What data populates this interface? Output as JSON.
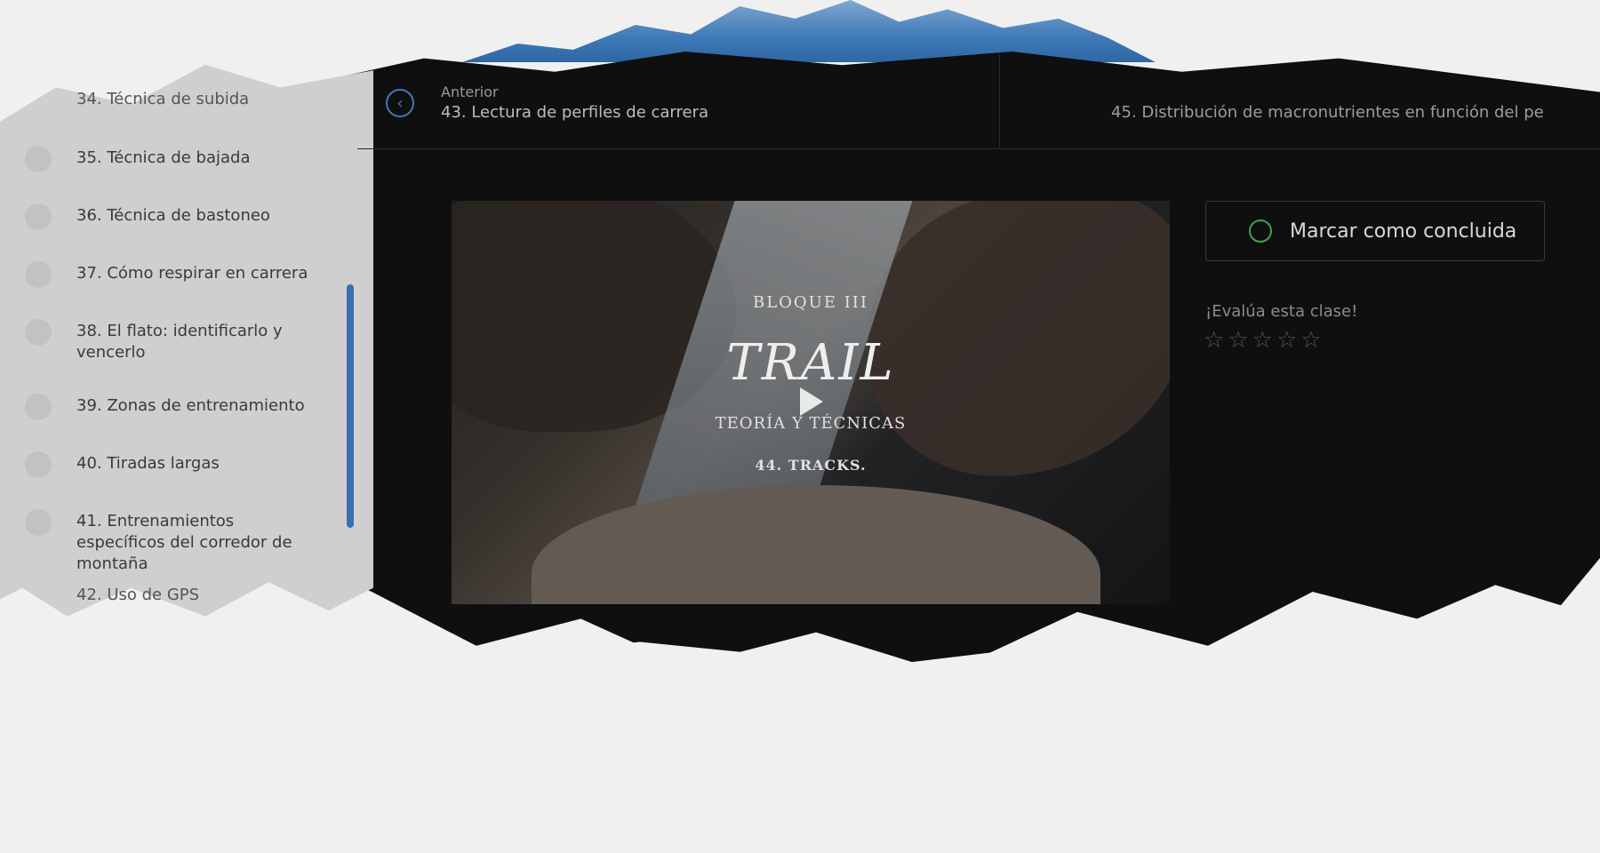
{
  "sidebar": {
    "lessons": [
      {
        "label": "34. Técnica de subida",
        "partial": true
      },
      {
        "label": "35. Técnica de bajada"
      },
      {
        "label": "36. Técnica de bastoneo"
      },
      {
        "label": "37. Cómo respirar en carrera"
      },
      {
        "label": "38. El flato: identificarlo y vencerlo"
      },
      {
        "label": "39. Zonas de entrenamiento"
      },
      {
        "label": "40. Tiradas largas"
      },
      {
        "label": "41. Entrenamientos específicos del corredor de montaña"
      },
      {
        "label": "42. Uso de GPS",
        "partial": true
      }
    ]
  },
  "topnav": {
    "prev": {
      "kicker": "Anterior",
      "title": "43. Lectura de perfiles de carrera",
      "icon": "chevron-left-icon"
    },
    "next": {
      "title": "45. Distribución de macronutrientes en función del pe"
    }
  },
  "video": {
    "bloque": "BLOQUE  III",
    "trail": "TRAIL",
    "subtitle": "TEORÍA Y TÉCNICAS",
    "track": "44. TRACKS."
  },
  "panel": {
    "mark_label": "Marcar como concluida",
    "rate_label": "¡Evalúa esta clase!",
    "stars_count": 5,
    "rating": 0
  },
  "colors": {
    "accent": "#3f7ab8",
    "done": "#3fa34d",
    "dark": "#0f0f0f"
  }
}
